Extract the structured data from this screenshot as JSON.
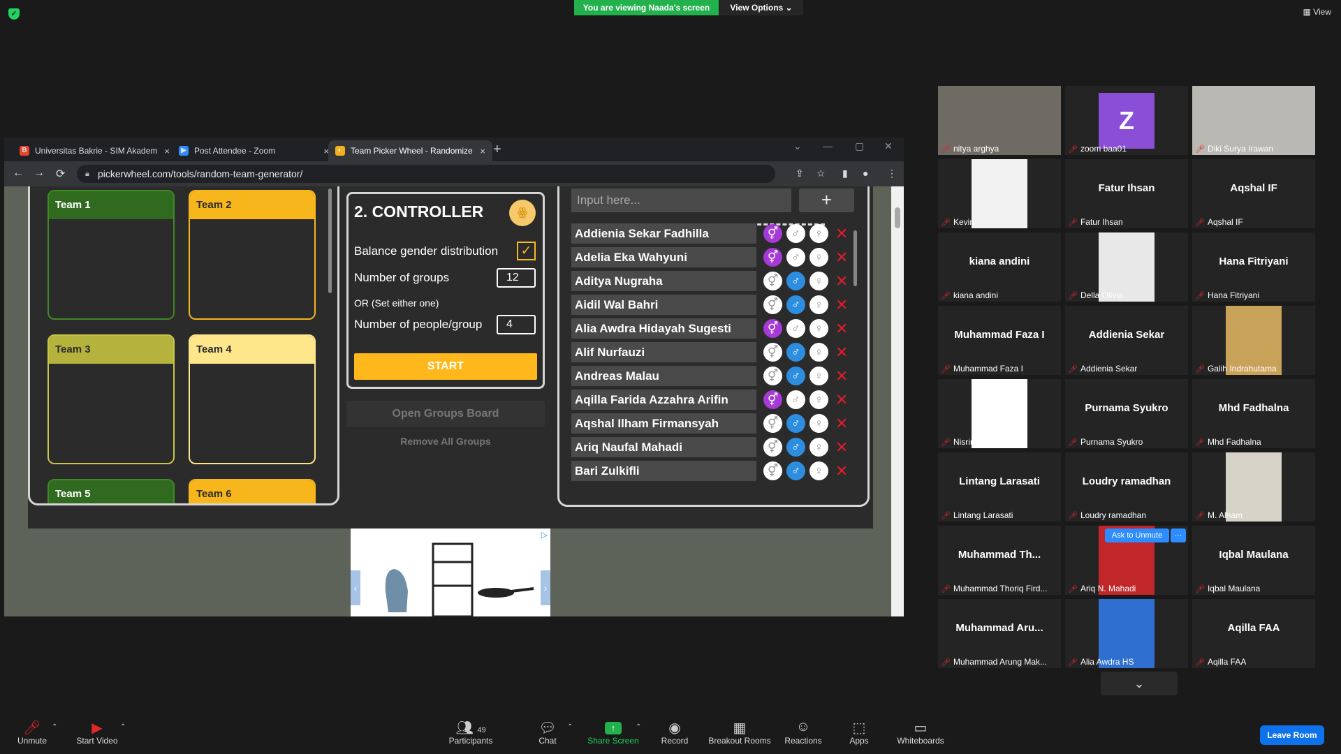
{
  "zoom": {
    "viewing_banner": "You are viewing Naada's screen",
    "view_options": "View Options ⌄",
    "view": "View",
    "shield": "✓"
  },
  "browser": {
    "tabs": [
      {
        "title": "Universitas Bakrie - SIM Akadem",
        "close": "×",
        "fav": "B",
        "favcolor": "#e8452c"
      },
      {
        "title": "Post Attendee - Zoom",
        "close": "×",
        "fav": "▶",
        "favcolor": "#2d8cff"
      },
      {
        "title": "Team Picker Wheel - Randomize",
        "close": "×",
        "fav": "◐",
        "favcolor": "#f3b21b"
      }
    ],
    "new_tab": "+",
    "url": "pickerwheel.com/tools/random-team-generator/",
    "nav": {
      "back": "←",
      "forward": "→",
      "reload": "⟳",
      "lock": "🔒︎"
    },
    "toolbar_icons": {
      "share": "⇪",
      "star": "☆",
      "sidepanel": "▮",
      "profile": "●",
      "menu": "⋮"
    },
    "window": {
      "dropdown": "⌄",
      "min": "—",
      "max": "▢",
      "close": "✕"
    }
  },
  "teams": [
    {
      "name": "Team 1",
      "color": "#2f6a1e",
      "border": "#3d8a26",
      "text": "#fff"
    },
    {
      "name": "Team 2",
      "color": "#f7b61b",
      "border": "#f7b61b",
      "text": "#2b2b2b"
    },
    {
      "name": "Team 3",
      "color": "#b5b33d",
      "border": "#c8c64a",
      "text": "#2b2b2b"
    },
    {
      "name": "Team 4",
      "color": "#fde78a",
      "border": "#fde78a",
      "text": "#2b2b2b"
    },
    {
      "name": "Team 5",
      "color": "#2f6a1e",
      "border": "#3d8a26",
      "text": "#fff"
    },
    {
      "name": "Team 6",
      "color": "#f7b61b",
      "border": "#f7b61b",
      "text": "#2b2b2b"
    }
  ],
  "controller": {
    "title": "2. CONTROLLER",
    "logo": "ꙮ",
    "balance_label": "Balance gender distribution",
    "balance_checked": "✓",
    "groups_label": "Number of groups",
    "groups_value": "12",
    "or_label": "OR (Set either one)",
    "people_label": "Number of people/group",
    "people_value": "4",
    "start": "START",
    "open_groups": "Open Groups Board",
    "remove_groups": "Remove All Groups"
  },
  "entries": {
    "placeholder": "Input here...",
    "add": "+",
    "glyph_both": "⚥",
    "glyph_male": "♂",
    "glyph_female": "♀",
    "delete": "✕",
    "list": [
      {
        "name": "Addienia Sekar Fadhilla",
        "gender": "both"
      },
      {
        "name": "Adelia Eka Wahyuni",
        "gender": "both"
      },
      {
        "name": "Aditya Nugraha",
        "gender": "male"
      },
      {
        "name": "Aidil Wal Bahri",
        "gender": "male"
      },
      {
        "name": "Alia Awdra Hidayah Sugesti",
        "gender": "both"
      },
      {
        "name": "Alif Nurfauzi",
        "gender": "male"
      },
      {
        "name": "Andreas Malau",
        "gender": "male"
      },
      {
        "name": "Aqilla Farida Azzahra Arifin",
        "gender": "both"
      },
      {
        "name": "Aqshal Ilham Firmansyah",
        "gender": "male"
      },
      {
        "name": "Ariq Naufal Mahadi",
        "gender": "male"
      },
      {
        "name": "Bari Zulkifli",
        "gender": "male"
      }
    ]
  },
  "ad": {
    "prev": "‹",
    "next": "›",
    "choices": "▷"
  },
  "gallery": [
    {
      "big": "",
      "label": "nitya arghya",
      "photo": "#6f6a63",
      "full": true
    },
    {
      "big": "Z",
      "label": "zoom baa01",
      "avatar": true
    },
    {
      "big": "",
      "label": "Diki Surya Irawan",
      "photo": "#b9b8b3",
      "full": true
    },
    {
      "big": "",
      "label": "Kevin",
      "photo": "#f2f2f2"
    },
    {
      "big": "Fatur Ihsan",
      "label": "Fatur Ihsan"
    },
    {
      "big": "Aqshal IF",
      "label": "Aqshal IF"
    },
    {
      "big": "kiana andini",
      "label": "kiana andini"
    },
    {
      "big": "",
      "label": "Della Olivia",
      "photo": "#e8e8e8"
    },
    {
      "big": "Hana Fitriyani",
      "label": "Hana Fitriyani"
    },
    {
      "big": "Muhammad Faza I",
      "label": "Muhammad Faza I"
    },
    {
      "big": "Addienia Sekar",
      "label": "Addienia Sekar"
    },
    {
      "big": "",
      "label": "Galih Indrahutama",
      "photo": "#c9a25a"
    },
    {
      "big": "",
      "label": "Nisrina Salsabila",
      "photo": "#ffffff"
    },
    {
      "big": "Purnama Syukro",
      "label": "Purnama Syukro"
    },
    {
      "big": "Mhd Fadhalna",
      "label": "Mhd Fadhalna"
    },
    {
      "big": "Lintang Larasati",
      "label": "Lintang Larasati"
    },
    {
      "big": "Loudry ramadhan",
      "label": "Loudry ramadhan"
    },
    {
      "big": "",
      "label": "M. Alham",
      "photo": "#d7d2c8"
    },
    {
      "big": "Muhammad  Th...",
      "label": "Muhammad Thoriq Fird..."
    },
    {
      "big": "",
      "label": "Ariq N. Mahadi",
      "photo": "#c0262a"
    },
    {
      "big": "Iqbal Maulana",
      "label": "Iqbal Maulana"
    },
    {
      "big": "Muhammad  Aru...",
      "label": "Muhammad Arung Mak..."
    },
    {
      "big": "",
      "label": "Alia Awdra HS",
      "photo": "#2f6fd0"
    },
    {
      "big": "Aqilla FAA",
      "label": "Aqilla FAA"
    }
  ],
  "ask_to_unmute": "Ask to Unmute",
  "more": "···",
  "gallery_down": "⌄",
  "muted_icon": "🎤︎",
  "toolbar": {
    "unmute": "Unmute",
    "start_video": "Start Video",
    "participants": "Participants",
    "participant_count": "49",
    "chat": "Chat",
    "share_screen": "Share Screen",
    "record": "Record",
    "breakout_rooms": "Breakout Rooms",
    "reactions": "Reactions",
    "apps": "Apps",
    "whiteboards": "Whiteboards",
    "leave": "Leave Room",
    "icons": {
      "mic": "🎤︎",
      "video": "▶",
      "people": "👥︎",
      "chat": "💬︎",
      "share": "↑",
      "record": "◉",
      "breakout": "▦",
      "reactions": "☺",
      "apps": "⬚",
      "whiteboards": "▭"
    },
    "caret": "⌃"
  }
}
